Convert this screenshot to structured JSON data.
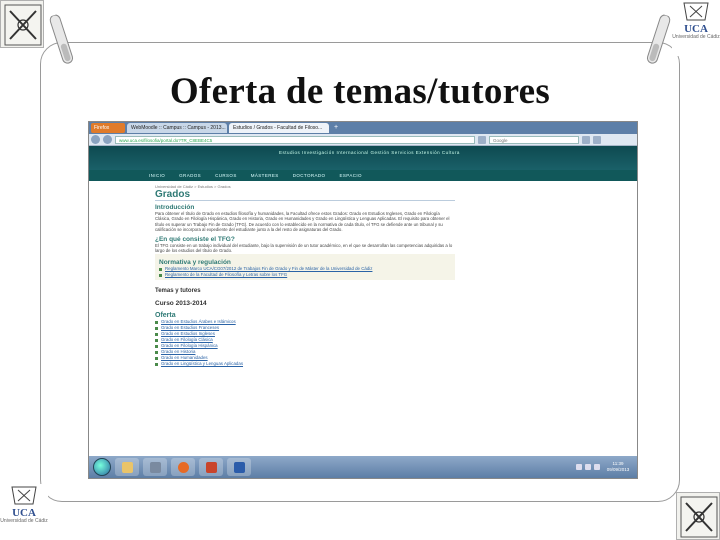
{
  "slide": {
    "title": "Oferta de temas/tutores",
    "logo_text": "UCA",
    "logo_subtext": "Universidad de Cádiz"
  },
  "browser": {
    "firefox_button": "Firefox",
    "tabs": [
      {
        "label": "WebMoodle :: Campus :: Campus - 2013..."
      },
      {
        "label": "Estudios / Grados - Facultad de Filoso..."
      }
    ],
    "url": "www.uca.es/filosofia/portal.do?TR_C8EBE4C5",
    "search_placeholder": "Google"
  },
  "page": {
    "site_nav": "Estudios   Investigación   Internacional   Gestión   Servicios   Extensión   Cultura",
    "menu": [
      "INICIO",
      "GRADOS",
      "CURSOS",
      "MÁSTERES",
      "DOCTORADO",
      "ESPACIO"
    ],
    "breadcrumb": "Universidad de Cádiz  >  Estudios  >  Grados",
    "heading": "Grados",
    "intro_heading": "Introducción",
    "intro_text": "Para obtener el título de Grado en estudios filosofía y humanidades, la Facultad ofrece estos Grados: Grado en Estudios Ingleses, Grado en Filología Clásica, Grado en Filología Hispánica, Grado en Historia, Grado en Humanidades y Grado en Lingüística y Lenguas Aplicadas. El requisito para obtener el título es superar un Trabajo Fin de Grado (TFG). De acuerdo con lo establecido en la normativa de cada título, el TFG se defiende ante un tribunal y su calificación se incorpora al expediente del estudiante junto a la del resto de asignaturas del Grado.",
    "tfg_heading": "¿En qué consiste el TFG?",
    "tfg_text": "El TFG consiste en un trabajo individual del estudiante, bajo la supervisión de un tutor académico, en el que se desarrollan las competencias adquiridas a lo largo de los estudios del título de Grado.",
    "normativa_heading": "Normativa y regulación",
    "normativa_links": [
      "Reglamento Marco UCA/CG07/2012 de Trabajos Fin de Grado y Fin de Máster de la Universidad de Cádiz",
      "Reglamento de la Facultad de Filosofía y Letras sobre los TFG"
    ],
    "temas_heading": "Temas y tutores",
    "curso_heading": "Curso 2013-2014",
    "oferta_heading": "Oferta",
    "oferta_links": [
      "Grado en Estudios Árabes e Islámicos",
      "Grado en Estudios Franceses",
      "Grado en Estudios Ingleses",
      "Grado en Filología Clásica",
      "Grado en Filología Hispánica",
      "Grado en Historia",
      "Grado en Humanidades",
      "Grado en Lingüística y Lenguas Aplicadas"
    ]
  },
  "taskbar": {
    "time": "11:39",
    "date": "09/09/2013",
    "apps": [
      {
        "name": "explorer-icon",
        "color": "#e9c46a"
      },
      {
        "name": "media-icon",
        "color": "#7a8aa0"
      },
      {
        "name": "firefox-icon",
        "color": "#e66a25"
      },
      {
        "name": "powerpoint-icon",
        "color": "#c9442b"
      },
      {
        "name": "word-icon",
        "color": "#2b5caa"
      }
    ]
  }
}
